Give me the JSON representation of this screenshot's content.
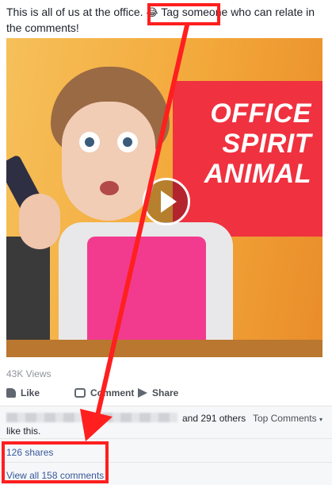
{
  "post": {
    "text_before": "This is all of us at the office.",
    "emoji": "😂",
    "tag_text": "Tag someone",
    "text_after": "who can relate in the comments!"
  },
  "video": {
    "overlay_lines": [
      "OFFICE",
      "SPIRIT",
      "ANIMAL"
    ],
    "views": "43K Views"
  },
  "actions": {
    "like": "Like",
    "comment": "Comment",
    "share": "Share"
  },
  "reactions": {
    "others_text": "and 291 others",
    "like_this_text": "like this.",
    "top_comments": "Top Comments",
    "top_comments_caret": "▾"
  },
  "footer": {
    "shares": "126 shares",
    "view_all": "View all 158 comments"
  },
  "annotation": {
    "color": "#ff1f1f"
  },
  "colors": {
    "link": "#365899",
    "muted": "#90949c",
    "overlay_red": "#f0313f"
  }
}
